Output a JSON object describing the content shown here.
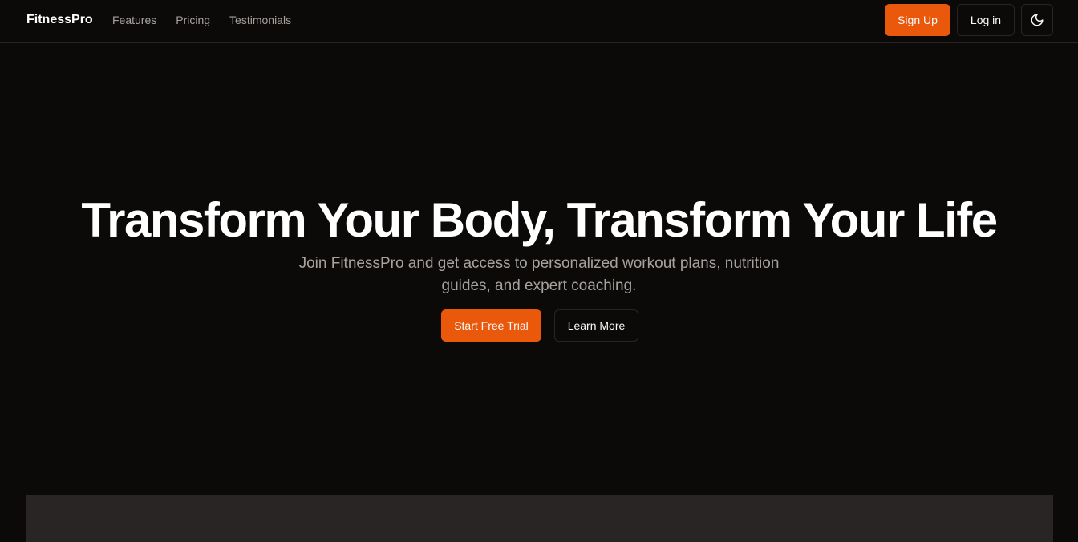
{
  "nav": {
    "brand": "FitnessPro",
    "links": [
      "Features",
      "Pricing",
      "Testimonials"
    ],
    "signup_label": "Sign Up",
    "login_label": "Log in",
    "theme_icon": "moon-icon"
  },
  "hero": {
    "title": "Transform Your Body, Transform Your Life",
    "subtitle": "Join FitnessPro and get access to personalized workout plans, nutrition guides, and expert coaching.",
    "primary_cta": "Start Free Trial",
    "secondary_cta": "Learn More"
  },
  "colors": {
    "background": "#0c0a09",
    "accent": "#ea580c",
    "muted_text": "#a8a29e",
    "border": "#292524"
  }
}
